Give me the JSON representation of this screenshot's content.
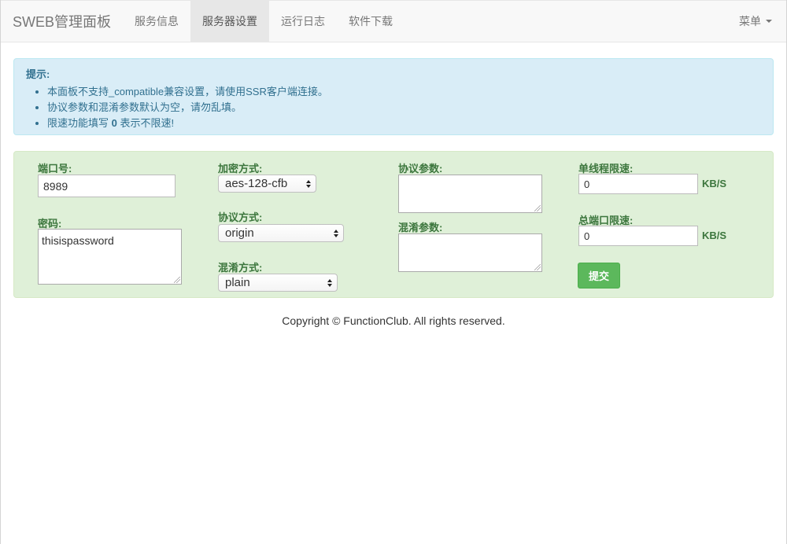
{
  "navbar": {
    "brand": "SWEB管理面板",
    "items": [
      "服务信息",
      "服务器设置",
      "运行日志",
      "软件下载"
    ],
    "active_index": 1,
    "menu_label": "菜单"
  },
  "alert": {
    "title": "提示:",
    "items": [
      "本面板不支持_compatible兼容设置，请使用SSR客户端连接。",
      "协议参数和混淆参数默认为空，请勿乱填。"
    ],
    "item3_before": "限速功能填写 ",
    "item3_bold": "0",
    "item3_after": " 表示不限速!"
  },
  "form": {
    "port_label": "端口号:",
    "port_value": "8989",
    "password_label": "密码:",
    "password_value": "thisispassword",
    "method_label": "加密方式:",
    "method_value": "aes-128-cfb",
    "protocol_label": "协议方式:",
    "protocol_value": "origin",
    "obfs_label": "混淆方式:",
    "obfs_value": "plain",
    "protocol_param_label": "协议参数:",
    "protocol_param_value": "",
    "obfs_param_label": "混淆参数:",
    "obfs_param_value": "",
    "thread_limit_label": "单线程限速:",
    "thread_limit_value": "0",
    "port_limit_label": "总端口限速:",
    "port_limit_value": "0",
    "unit": "KB/S",
    "submit_label": "提交"
  },
  "footer": "Copyright © FunctionClub. All rights reserved.",
  "colors": {
    "alert_bg": "#d9edf7",
    "alert_text": "#31708f",
    "panel_bg": "#dff0d8",
    "label_green": "#3c763d",
    "button_green": "#5cb85c"
  }
}
